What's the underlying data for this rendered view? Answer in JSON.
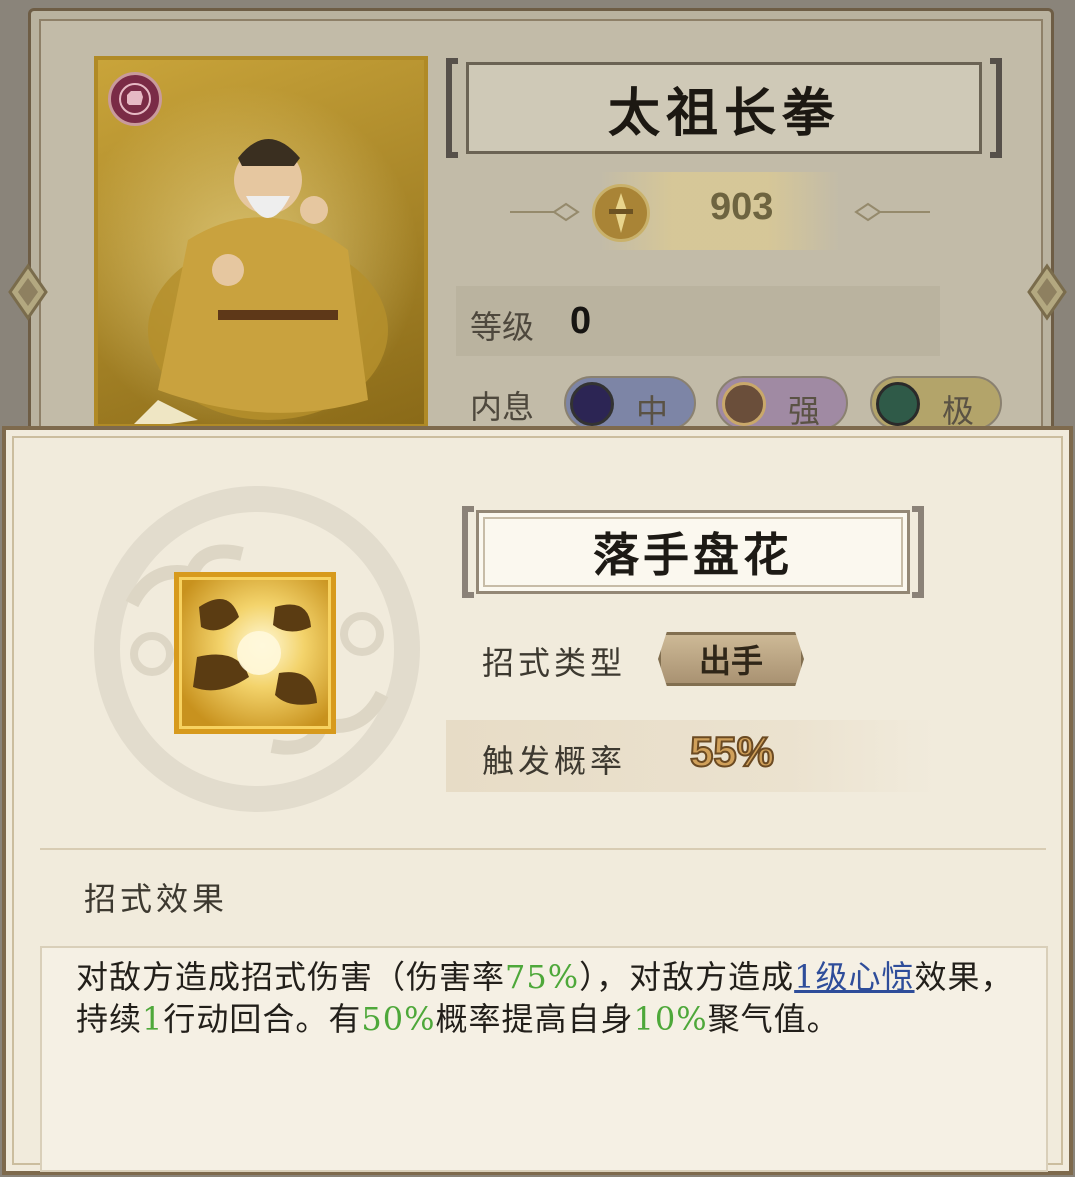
{
  "background_panel": {
    "weapon_name": "太祖长拳",
    "power": "903",
    "level_label": "等级",
    "level_value": "0",
    "neixi_label": "内息",
    "neixi_options": [
      "中",
      "强",
      "极"
    ]
  },
  "skill": {
    "name": "落手盘花",
    "type_label": "招式类型",
    "type_value": "出手",
    "trigger_label": "触发概率",
    "trigger_value": "55%",
    "effect_title": "招式效果",
    "effect": {
      "p1": "对敌方造成招式伤害（伤害率",
      "v1": "75%",
      "p2": "），对敌方造成",
      "link": "1级心惊",
      "p3": "效果，持续",
      "v2": "1",
      "p4": "行动回合。有",
      "v3": "50%",
      "p5": "概率提高自身",
      "v4": "10%",
      "p6": "聚气值。"
    }
  },
  "colors": {
    "highlight_green": "#4ea83a",
    "link_blue": "#2e4d9a",
    "gold": "#d79a1d"
  }
}
